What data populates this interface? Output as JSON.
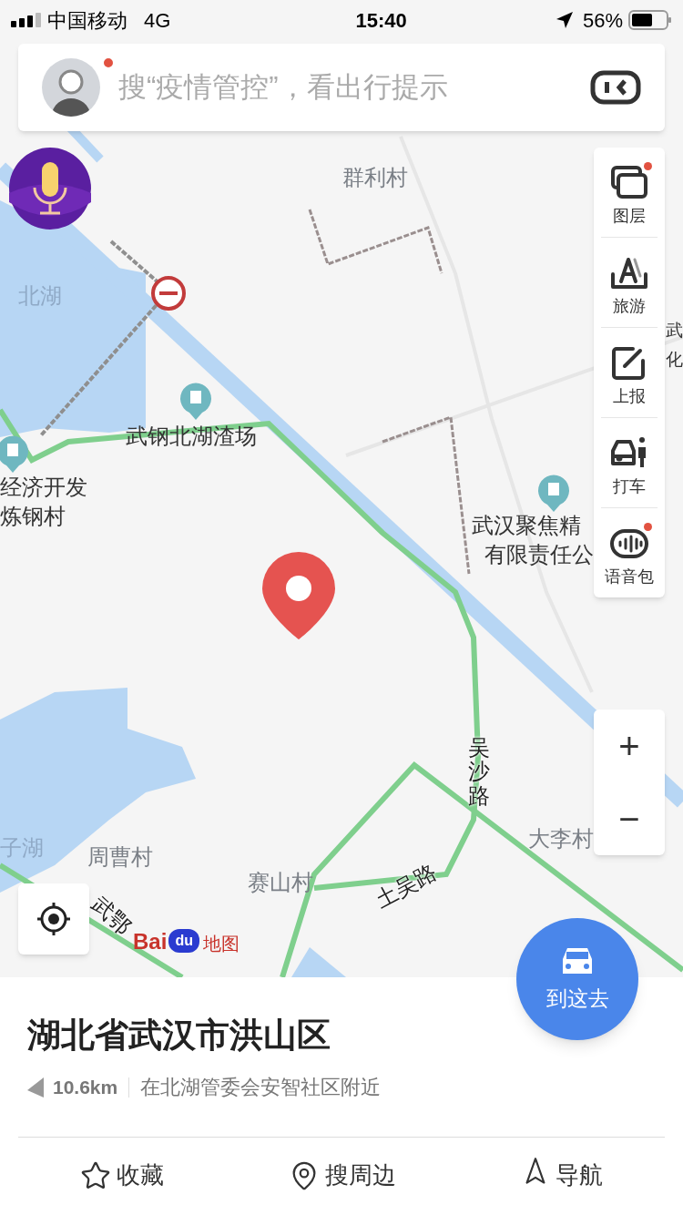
{
  "status_bar": {
    "carrier": "中国移动",
    "network": "4G",
    "time": "15:40",
    "battery": "56%"
  },
  "search": {
    "placeholder": "搜“疫情管控”，看出行提示",
    "avatar_badge": true
  },
  "map_labels": [
    {
      "text": "群利村",
      "kind": "place"
    },
    {
      "text": "北湖",
      "kind": "water"
    },
    {
      "text": "武钢北湖渣场",
      "kind": "poi"
    },
    {
      "text": "经济开发",
      "kind": "poi"
    },
    {
      "text": "炼钢村",
      "kind": "poi"
    },
    {
      "text": "武汉聚焦精",
      "kind": "poi"
    },
    {
      "text": "有限责任公",
      "kind": "poi"
    },
    {
      "text": "武",
      "kind": "poi"
    },
    {
      "text": "化",
      "kind": "poi"
    },
    {
      "text": "吴沙路",
      "kind": "road"
    },
    {
      "text": "大李村",
      "kind": "place"
    },
    {
      "text": "子湖",
      "kind": "water"
    },
    {
      "text": "周曹村",
      "kind": "place"
    },
    {
      "text": "赛山村",
      "kind": "place"
    },
    {
      "text": "土吴路",
      "kind": "road"
    },
    {
      "text": "武鄂",
      "kind": "road"
    }
  ],
  "toolbar": [
    {
      "label": "图层",
      "kind": "layers",
      "badge": true
    },
    {
      "label": "旅游",
      "kind": "travel",
      "badge": false
    },
    {
      "label": "上报",
      "kind": "report",
      "badge": false
    },
    {
      "label": "打车",
      "kind": "taxi",
      "badge": false
    },
    {
      "label": "语音包",
      "kind": "voice",
      "badge": true
    }
  ],
  "zoom": {
    "in": "+",
    "out": "−"
  },
  "logo": {
    "part_1": "Bai",
    "part_2": "du",
    "part_3": "地图"
  },
  "go_button": "到这去",
  "place": {
    "title": "湖北省武汉市洪山区",
    "distance": "10.6km",
    "nearby": "在北湖管委会安智社区附近"
  },
  "actions": [
    {
      "label": "收藏",
      "kind": "favorite"
    },
    {
      "label": "搜周边",
      "kind": "nearby"
    },
    {
      "label": "导航",
      "kind": "navigate"
    }
  ]
}
